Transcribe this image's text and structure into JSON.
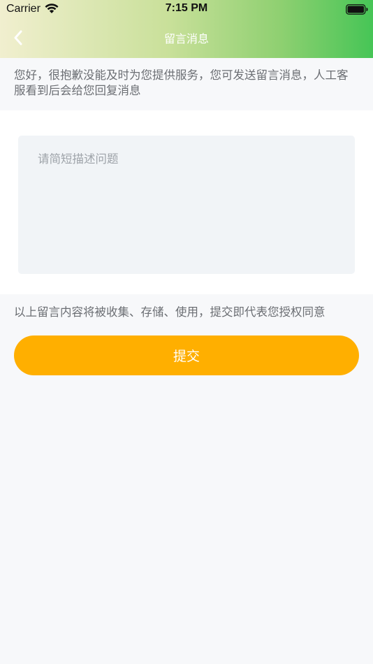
{
  "status_bar": {
    "carrier": "Carrier",
    "time": "7:15 PM"
  },
  "nav": {
    "title": "留言消息",
    "back_icon": "chevron-left-icon"
  },
  "notice": {
    "text": "您好，很抱歉没能及时为您提供服务，您可发送留言消息，人工客服看到后会给您回复消息"
  },
  "form": {
    "message_placeholder": "请简短描述问题",
    "message_value": "",
    "consent_text": "以上留言内容将被收集、存储、使用，提交即代表您授权同意",
    "submit_label": "提交"
  },
  "colors": {
    "header_gradient_start": "#f1efcf",
    "header_gradient_end": "#46c556",
    "submit_button": "#ffaf00",
    "input_background": "#f1f4f7",
    "page_background": "#f7f8fa"
  }
}
